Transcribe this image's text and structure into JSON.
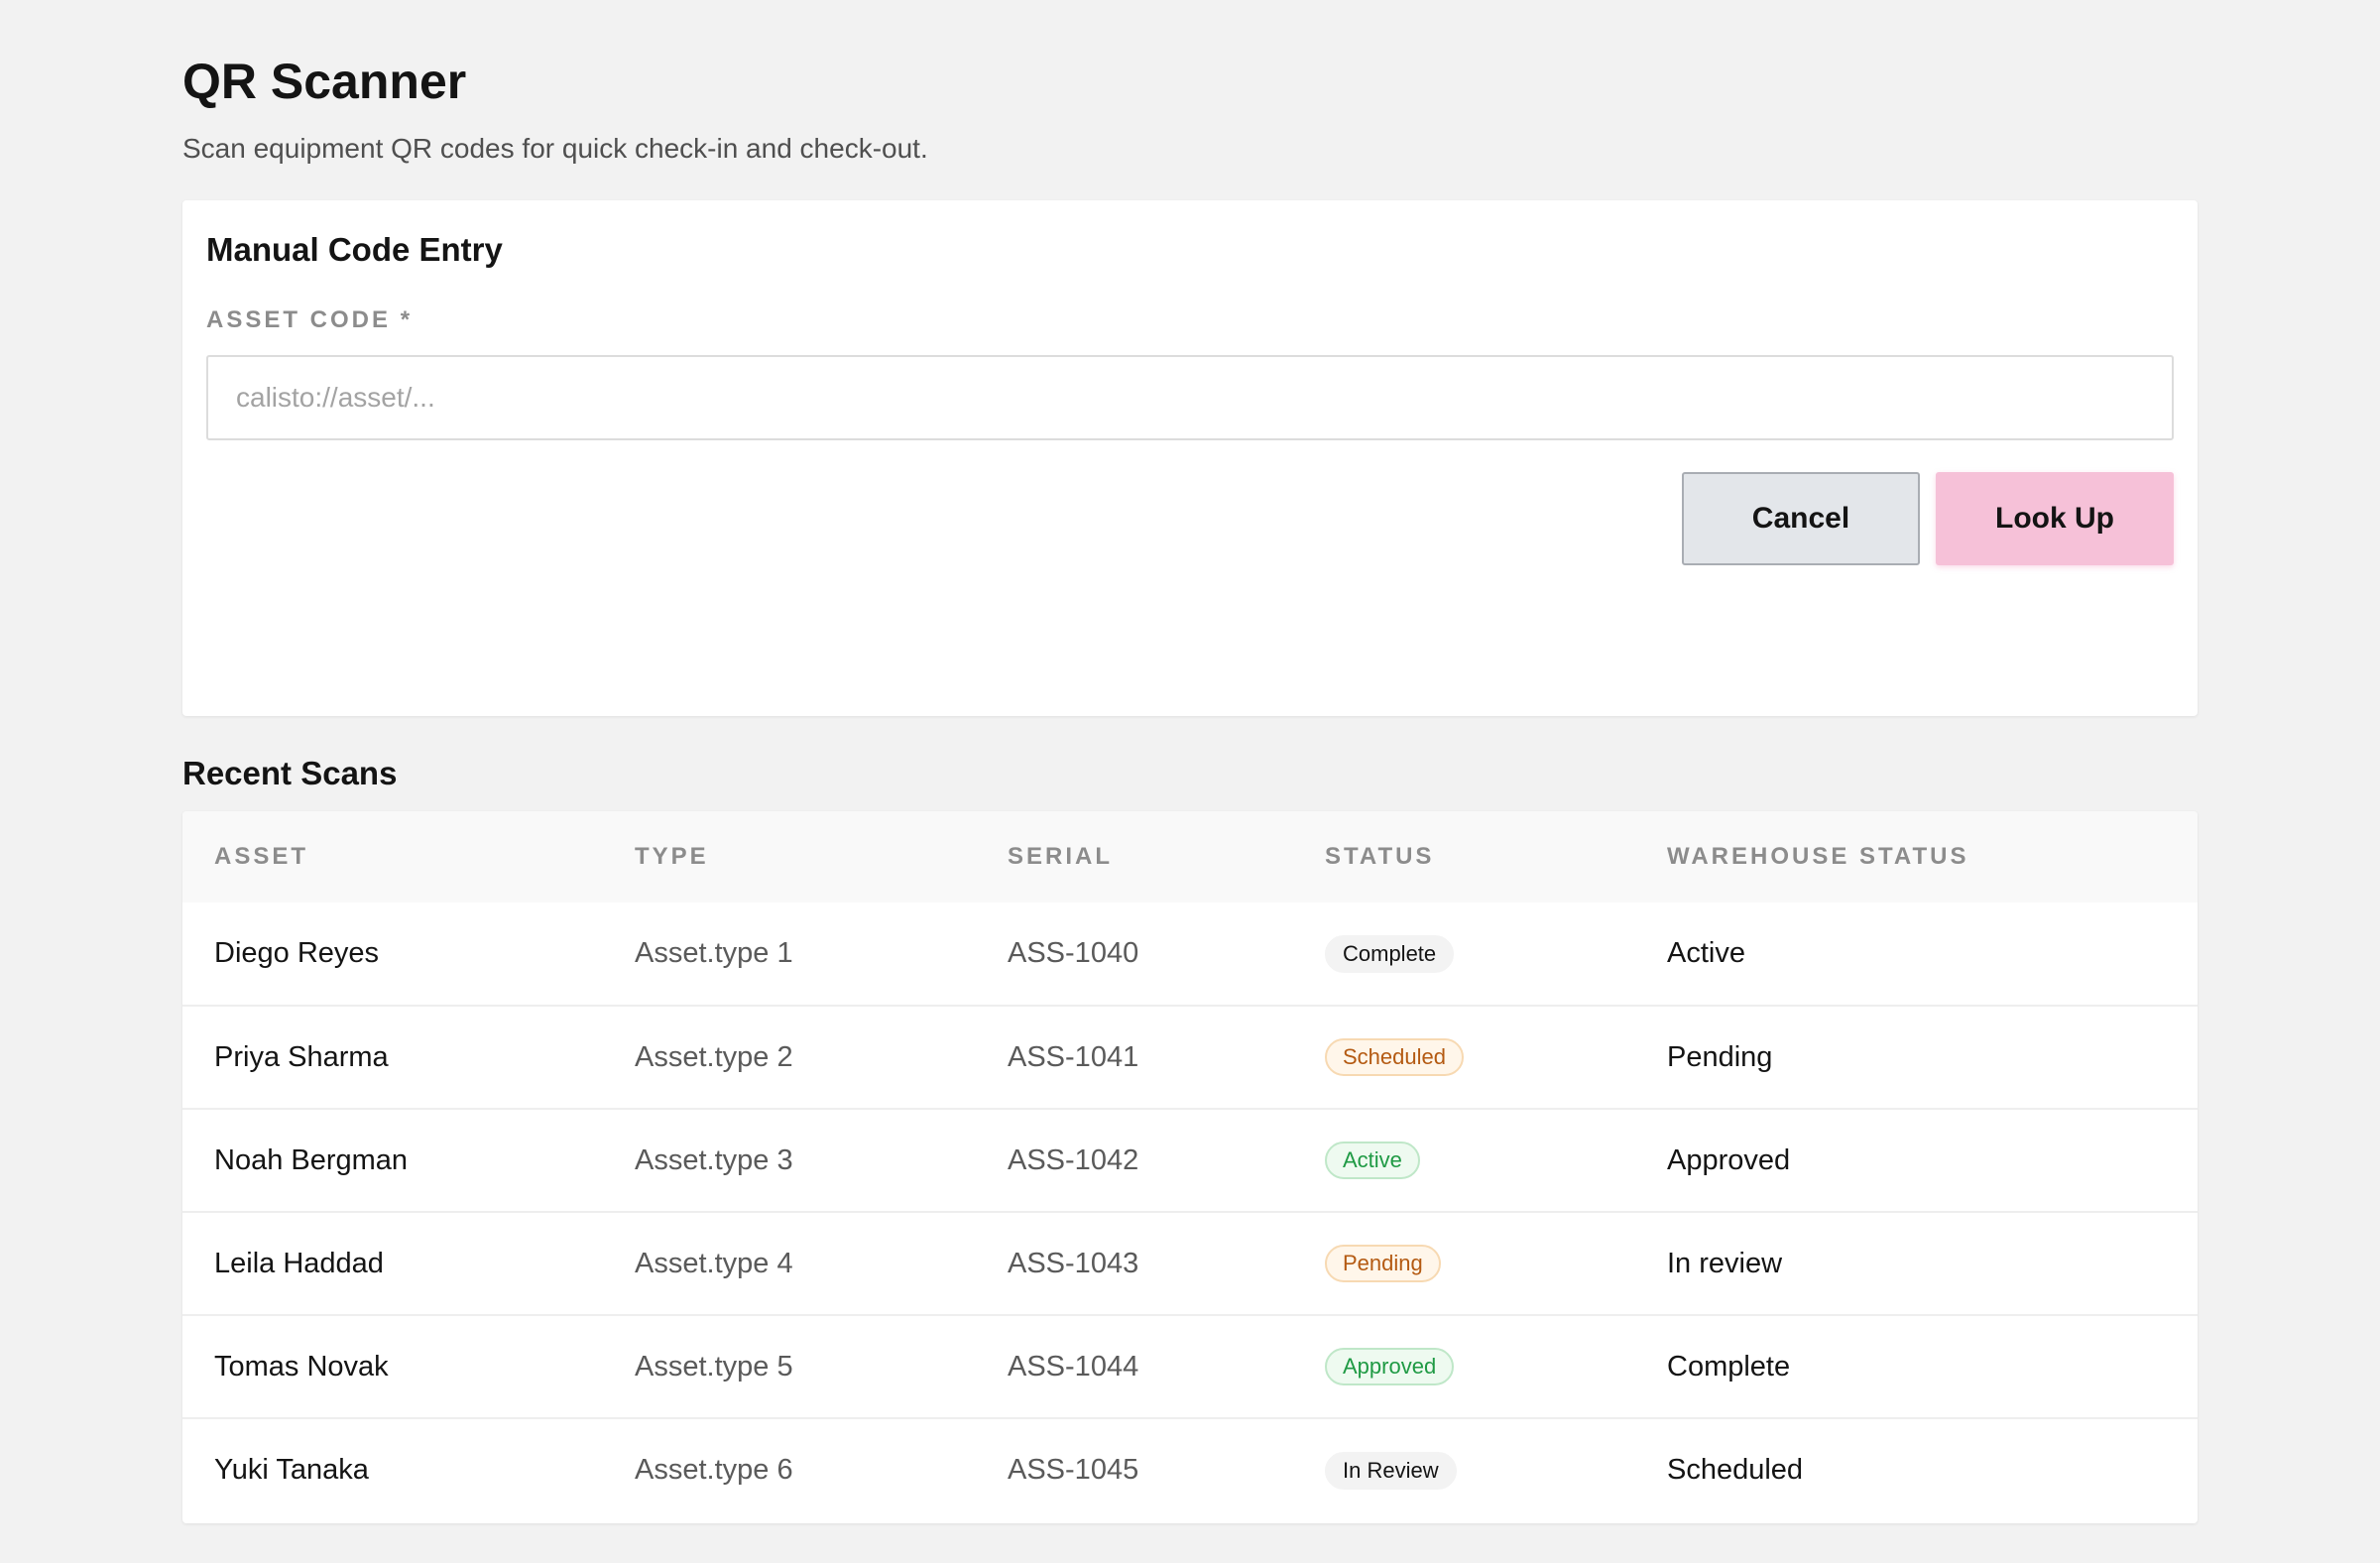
{
  "header": {
    "title": "QR Scanner",
    "subtitle": "Scan equipment QR codes for quick check-in and check-out."
  },
  "manual_entry": {
    "title": "Manual Code Entry",
    "field_label": "ASSET CODE *",
    "input_value": "",
    "input_placeholder": "calisto://asset/...",
    "cancel_label": "Cancel",
    "lookup_label": "Look Up"
  },
  "recent_scans": {
    "title": "Recent Scans",
    "columns": [
      "ASSET",
      "TYPE",
      "SERIAL",
      "STATUS",
      "WAREHOUSE STATUS"
    ],
    "rows": [
      {
        "asset": "Diego Reyes",
        "type": "Asset.type 1",
        "serial": "ASS-1040",
        "status": "Complete",
        "status_tone": "neutral",
        "warehouse_status": "Active"
      },
      {
        "asset": "Priya Sharma",
        "type": "Asset.type 2",
        "serial": "ASS-1041",
        "status": "Scheduled",
        "status_tone": "warn",
        "warehouse_status": "Pending"
      },
      {
        "asset": "Noah Bergman",
        "type": "Asset.type 3",
        "serial": "ASS-1042",
        "status": "Active",
        "status_tone": "success",
        "warehouse_status": "Approved"
      },
      {
        "asset": "Leila Haddad",
        "type": "Asset.type 4",
        "serial": "ASS-1043",
        "status": "Pending",
        "status_tone": "warn",
        "warehouse_status": "In review"
      },
      {
        "asset": "Tomas Novak",
        "type": "Asset.type 5",
        "serial": "ASS-1044",
        "status": "Approved",
        "status_tone": "success",
        "warehouse_status": "Complete"
      },
      {
        "asset": "Yuki Tanaka",
        "type": "Asset.type 6",
        "serial": "ASS-1045",
        "status": "In Review",
        "status_tone": "neutral",
        "warehouse_status": "Scheduled"
      }
    ]
  },
  "colors": {
    "background": "#f2f2f2",
    "primary_button": "#f6c1d8",
    "secondary_button": "#e3e6ea",
    "badge_warn_text": "#b45a12",
    "badge_success_text": "#1f9a44"
  }
}
